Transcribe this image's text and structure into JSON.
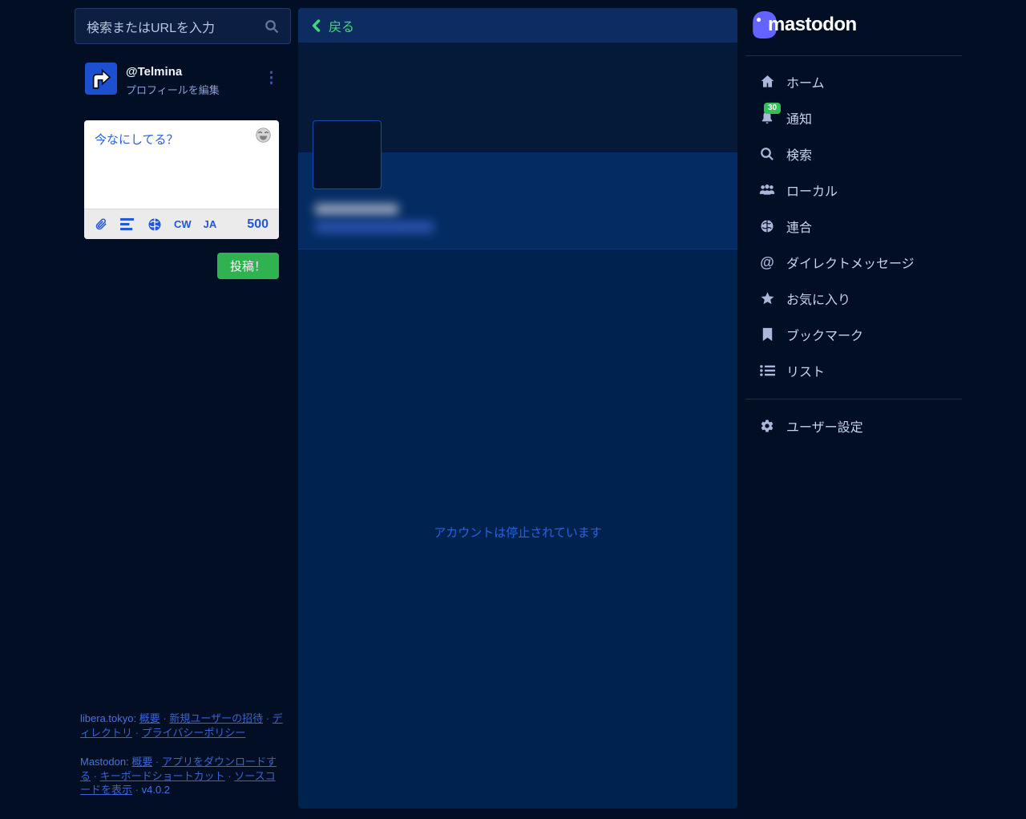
{
  "left": {
    "search": {
      "placeholder": "検索またはURLを入力"
    },
    "profile": {
      "username": "@Telmina",
      "edit_link": "プロフィールを編集"
    },
    "compose": {
      "placeholder": "今なにしてる？",
      "cw_label": "CW",
      "lang_label": "JA",
      "char_count": "500",
      "post_label": "投稿！"
    },
    "footer": {
      "separator": "·",
      "site_label": "libera.tokyo:",
      "site_links": [
        "概要",
        "新規ユーザーの招待",
        "ディレクトリ",
        "プライバシーポリシー"
      ],
      "mastodon_label": "Mastodon:",
      "mastodon_links": [
        "概要",
        "アプリをダウンロードする",
        "キーボードショートカット",
        "ソースコードを表示"
      ],
      "version": "v4.0.2"
    }
  },
  "middle": {
    "back_label": "戻る",
    "suspended_message": "アカウントは停止されています"
  },
  "sidebar": {
    "brand": "mastodon",
    "notification_count": "30",
    "items": [
      {
        "label": "ホーム"
      },
      {
        "label": "通知"
      },
      {
        "label": "検索"
      },
      {
        "label": "ローカル"
      },
      {
        "label": "連合"
      },
      {
        "label": "ダイレクトメッセージ"
      },
      {
        "label": "お気に入り"
      },
      {
        "label": "ブックマーク"
      },
      {
        "label": "リスト"
      }
    ],
    "settings_label": "ユーザー設定"
  },
  "colors": {
    "accent_blue": "#2b5fd9",
    "post_green": "#2fb350",
    "back_green": "#3fd97c",
    "badge_green": "#32c159",
    "brand_purple": "#6364ff"
  }
}
